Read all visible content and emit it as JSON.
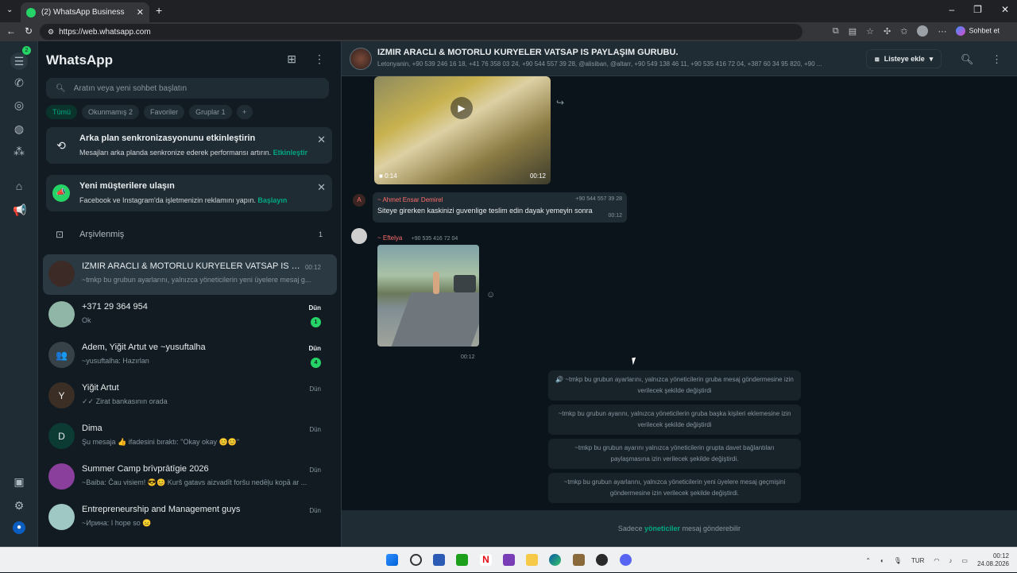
{
  "browser": {
    "tab_title": "(2) WhatsApp Business",
    "url": "https://web.whatsapp.com",
    "profile_button": "Sohbet et"
  },
  "sidebar": {
    "title": "WhatsApp",
    "rail_badge": "2",
    "search_placeholder": "Aratın veya yeni sohbet başlatın",
    "filters": [
      {
        "label": "Tümü",
        "active": true
      },
      {
        "label": "Okunmamış 2",
        "active": false
      },
      {
        "label": "Favoriler",
        "active": false
      },
      {
        "label": "Gruplar 1",
        "active": false
      }
    ],
    "sync_banner": {
      "title": "Arka plan senkronizasyonunu etkinleştirin",
      "text": "Mesajları arka planda senkronize ederek performansı artırın.",
      "link": "Etkinleştir"
    },
    "ads_banner": {
      "title": "Yeni müşterilere ulaşın",
      "text": "Facebook ve Instagram'da işletmenizin reklamını yapın.",
      "link": "Başlayın"
    },
    "archived": {
      "label": "Arşivlenmiş",
      "count": "1"
    },
    "chats": [
      {
        "name": "IZMIR ARACLI & MOTORLU KURYELER VATSAP IS PAYLA...",
        "last": "~tmkp bu grubun ayarlarını, yalnızca yöneticilerin yeni üyelere mesaj g...",
        "time": "00:12",
        "unread": "",
        "avatar": "",
        "avatar_color": "#3b2a26"
      },
      {
        "name": "+371 29 364 954",
        "last": "Ok",
        "time": "Dün",
        "unread": "1",
        "avatar": "",
        "avatar_color": "#8fb6a6"
      },
      {
        "name": "Adem, Yiğit Artut ve ~yusuftalha",
        "last": "~yusuftalha: Hazırlan",
        "time": "Dün",
        "unread": "4",
        "avatar": "👥",
        "avatar_color": "#374248"
      },
      {
        "name": "Yiğit Artut",
        "last": "✓✓ Zirat bankasının orada",
        "time": "Dün",
        "unread": "",
        "avatar": "Y",
        "avatar_color": "#3a2e25"
      },
      {
        "name": "Dima",
        "last": "Şu mesaja 👍 ifadesini bıraktı: \"Okay okay 😊😊\"",
        "time": "Dün",
        "unread": "",
        "avatar": "D",
        "avatar_color": "#0b3b33"
      },
      {
        "name": "Summer Camp brīvprātīgie 2026",
        "last": "~Baiba: Čau visiem! 😎😊 Kurš gatavs aizvadīt foršu nedēļu kopā ar ...",
        "time": "Dün",
        "unread": "",
        "avatar": "",
        "avatar_color": "#8a3f9c"
      },
      {
        "name": "Entrepreneurship and Management guys",
        "last": "~Ирина: I hope so 😑",
        "time": "Dün",
        "unread": "",
        "avatar": "",
        "avatar_color": "#9fc7c4"
      }
    ]
  },
  "conversation": {
    "title": "IZMIR ARACLI & MOTORLU KURYELER VATSAP IS PAYLAŞIM GURUBU.",
    "participants": "Letonyanin, +90 539 246 16 18, +41 76 358 03 24, +90 544 557 39 28, @alisiban, @altarr, +90 549 138 46 11, +90 535 416 72 04, +387 60 34 95 820, +90 ...",
    "list_button": "Listeye ekle",
    "video": {
      "duration": "0:14",
      "time": "00:12"
    },
    "msg1": {
      "avatar": "A",
      "sender": "~ Ahmet Ensar Demirel",
      "phone": "+90 544 557 39 28",
      "text": "Siteye girerken kaskinizi guvenlige teslim edin dayak yemeyin sonra",
      "time": "00:12"
    },
    "msg2": {
      "sender": "~ Eftelya",
      "phone": "+90 535 416 72 04",
      "time": "00:12"
    },
    "system_messages": [
      "🔊 ~tmkp bu grubun ayarlarını, yalnızca yöneticilerin gruba mesaj göndermesine izin verilecek şekilde değiştirdi",
      "~tmkp bu grubun ayarını, yalnızca yöneticilerin gruba başka kişileri eklemesine izin verilecek şekilde değiştirdi",
      "~tmkp bu grubun ayarını yalnızca yöneticilerin grupta davet bağlantıları paylaşmasına izin verilecek şekilde değiştirdi.",
      "~tmkp bu grubun ayarlarını, yalnızca yöneticilerin yeni üyelere mesaj geçmişini göndermesine izin verilecek şekilde değiştirdi."
    ],
    "footer_prefix": "Sadece",
    "footer_bold": "yöneticiler",
    "footer_suffix": "mesaj gönderebilir"
  },
  "taskbar": {
    "lang": "TUR",
    "time": "00:12",
    "date": "24.08.2026"
  }
}
